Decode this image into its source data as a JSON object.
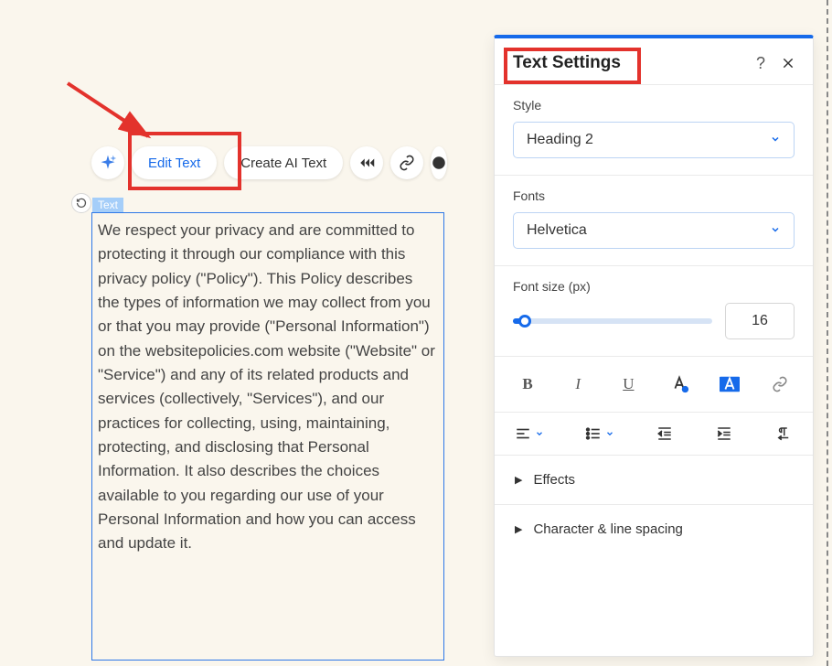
{
  "toolbar": {
    "editText": "Edit Text",
    "createAIText": "Create AI Text",
    "textBadge": "Text"
  },
  "textBlock": {
    "content": "We respect your privacy and are committed to protecting it through our compliance with this privacy policy (\"Policy\"). This Policy describes the types of information we may collect from you or that you may provide (\"Personal Information\") on the websitepolicies.com website (\"Website\" or \"Service\") and any of its related products and services (collectively, \"Services\"), and our practices for collecting, using, maintaining, protecting, and disclosing that Personal Information. It also describes the choices available to you regarding our use of your Personal Information and how you can access and update it."
  },
  "panel": {
    "title": "Text Settings",
    "style": {
      "label": "Style",
      "value": "Heading 2"
    },
    "fonts": {
      "label": "Fonts",
      "value": "Helvetica"
    },
    "fontSize": {
      "label": "Font size (px)",
      "value": "16"
    },
    "format": {
      "bold": "B",
      "italic": "I",
      "underline": "U"
    },
    "accordions": {
      "effects": "Effects",
      "spacing": "Character & line spacing"
    }
  }
}
